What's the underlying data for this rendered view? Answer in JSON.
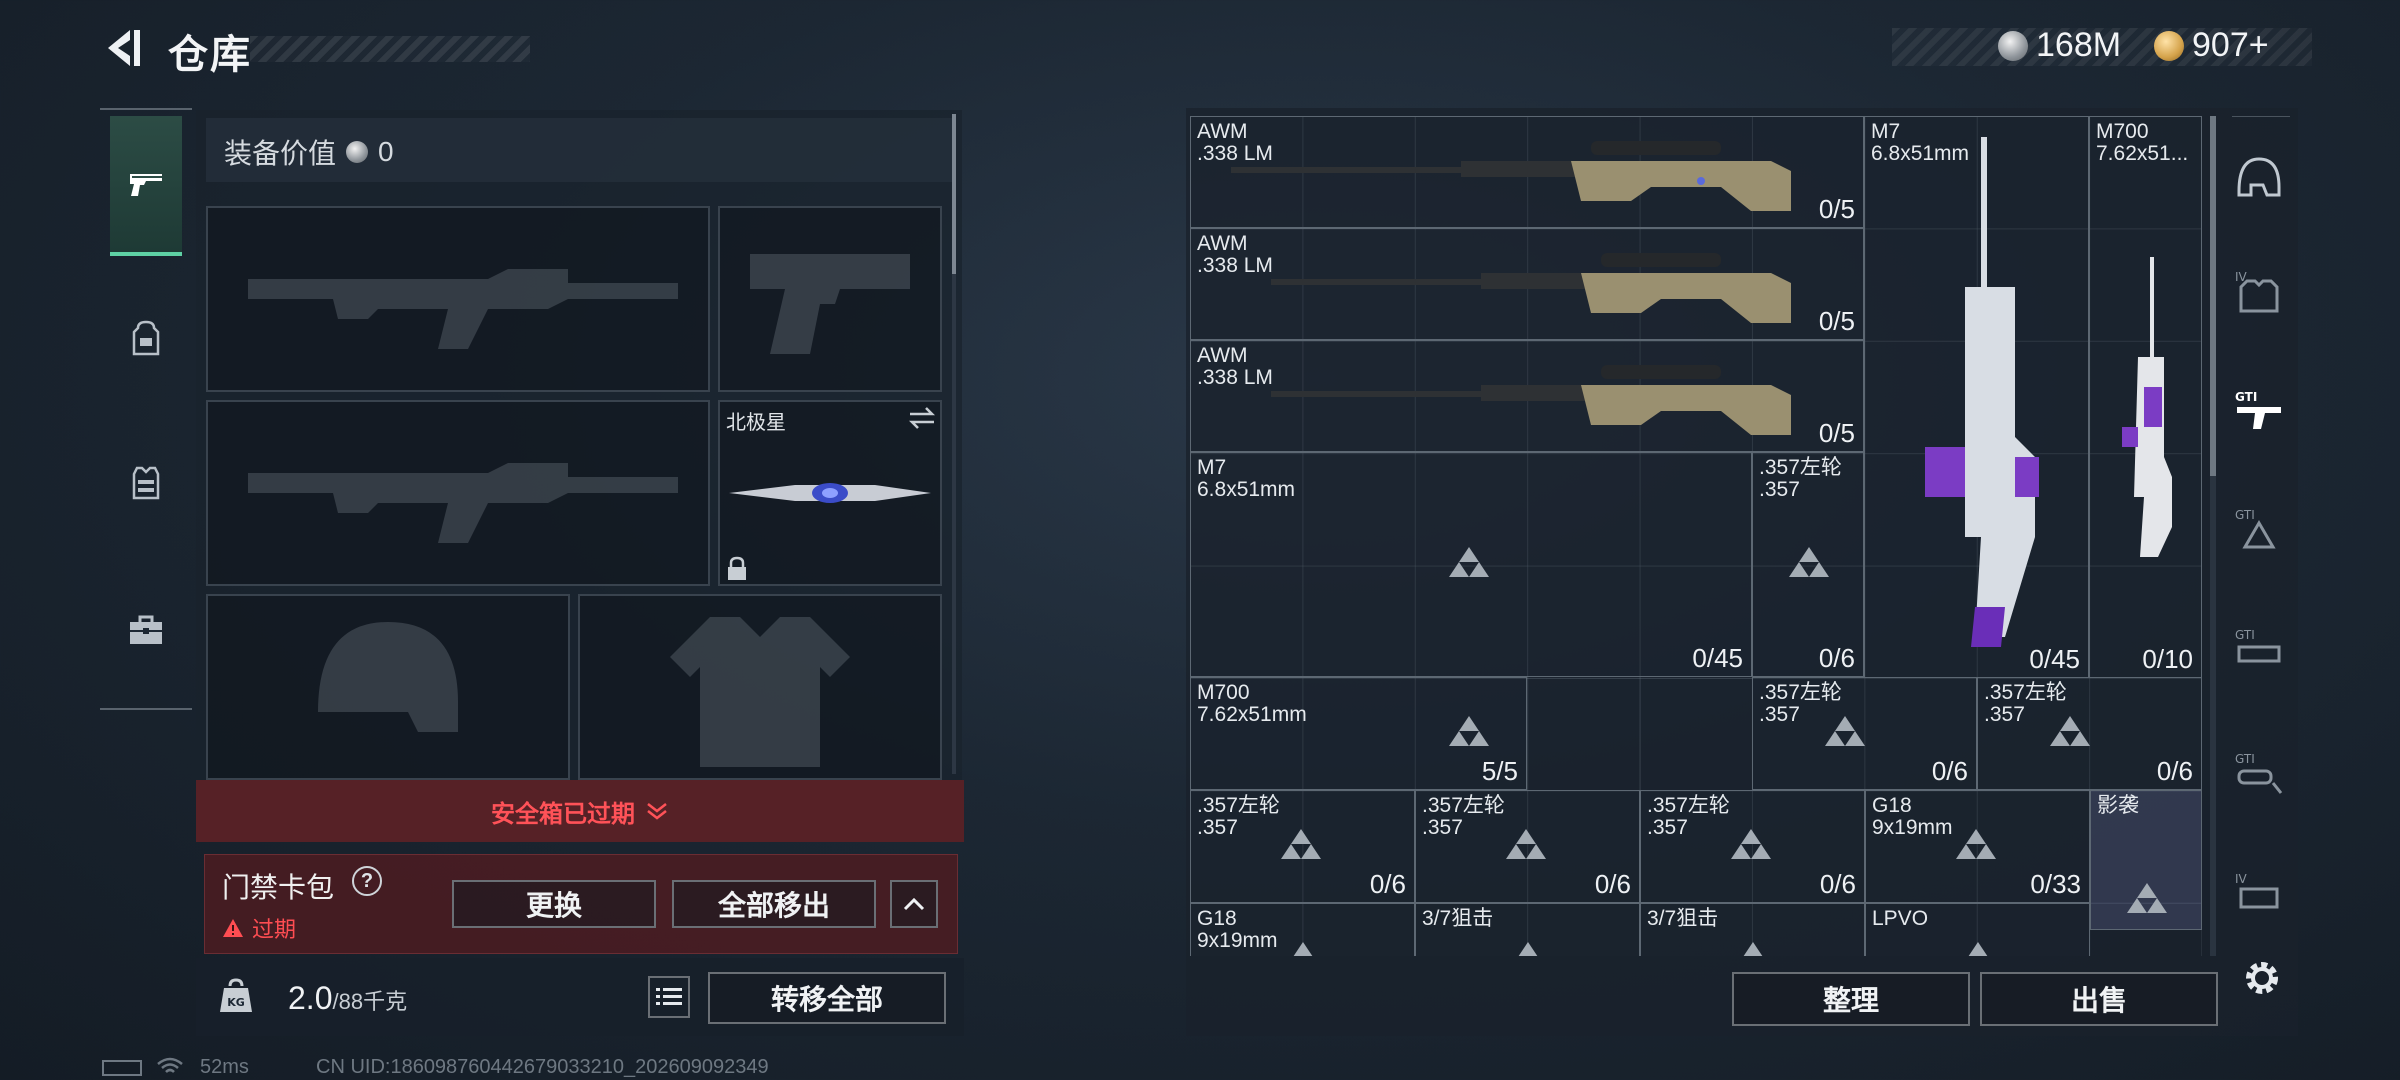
{
  "header": {
    "title": "仓库",
    "currencies": [
      {
        "icon": "silver-coin-icon",
        "value": "168M"
      },
      {
        "icon": "gold-coin-icon",
        "value": "907+"
      }
    ]
  },
  "rail": {
    "tabs": [
      {
        "icon": "pistol-icon",
        "active": true
      },
      {
        "icon": "backpack-icon",
        "active": false
      },
      {
        "icon": "vest-icon",
        "active": false
      },
      {
        "icon": "toolbox-icon",
        "active": false
      }
    ]
  },
  "equipment": {
    "value_label": "装备价值",
    "value": "0",
    "knife_name": "北极星",
    "safebox_status": "安全箱已过期",
    "keycard": {
      "title": "门禁卡包",
      "help": "?",
      "status": "过期",
      "replace_label": "更换",
      "remove_all_label": "全部移出"
    },
    "weight": {
      "current": "2.0",
      "max": "/88千克",
      "icon": "kg-weight-icon"
    },
    "transfer_all_label": "转移全部"
  },
  "inventory": {
    "items": [
      {
        "name": "AWM\n.338 LM",
        "count": "0/5"
      },
      {
        "name": "AWM\n.338 LM",
        "count": "0/5"
      },
      {
        "name": "AWM\n.338 LM",
        "count": "0/5"
      },
      {
        "name": "M7\n6.8x51mm",
        "count": "0/45"
      },
      {
        "name": "M700\n7.62x51...",
        "count": "0/10"
      },
      {
        "name": "M7\n6.8x51mm",
        "count": "0/45"
      },
      {
        "name": ".357左轮\n.357",
        "count": "0/6"
      },
      {
        "name": "M700\n7.62x51mm",
        "count": "5/5"
      },
      {
        "name": ".357左轮\n.357",
        "count": "0/6"
      },
      {
        "name": ".357左轮\n.357",
        "count": "0/6"
      },
      {
        "name": ".357左轮\n.357",
        "count": "0/6"
      },
      {
        "name": ".357左轮\n.357",
        "count": "0/6"
      },
      {
        "name": ".357左轮\n.357",
        "count": "0/6"
      },
      {
        "name": "G18\n9x19mm",
        "count": "0/33"
      },
      {
        "name": "影袭",
        "count": ""
      },
      {
        "name": "G18\n9x19mm",
        "count": ""
      },
      {
        "name": "3/7狙击",
        "count": ""
      },
      {
        "name": "3/7狙击",
        "count": ""
      },
      {
        "name": "LPVO",
        "count": ""
      }
    ],
    "sort_label": "整理",
    "sell_label": "出售",
    "side_tabs": [
      "helmet-icon",
      "armor-icon",
      "rifle-icon",
      "ammo-icon",
      "attachment-icon",
      "scope-icon",
      "mag-icon"
    ]
  },
  "status_bar": {
    "ping": "52ms",
    "uid": "CN UID:18609876044267903321​0_202609092349"
  },
  "colors": {
    "accent_green": "#5ed1a4",
    "expired_red": "#ff4d52",
    "panel_dark": "#19222d"
  }
}
